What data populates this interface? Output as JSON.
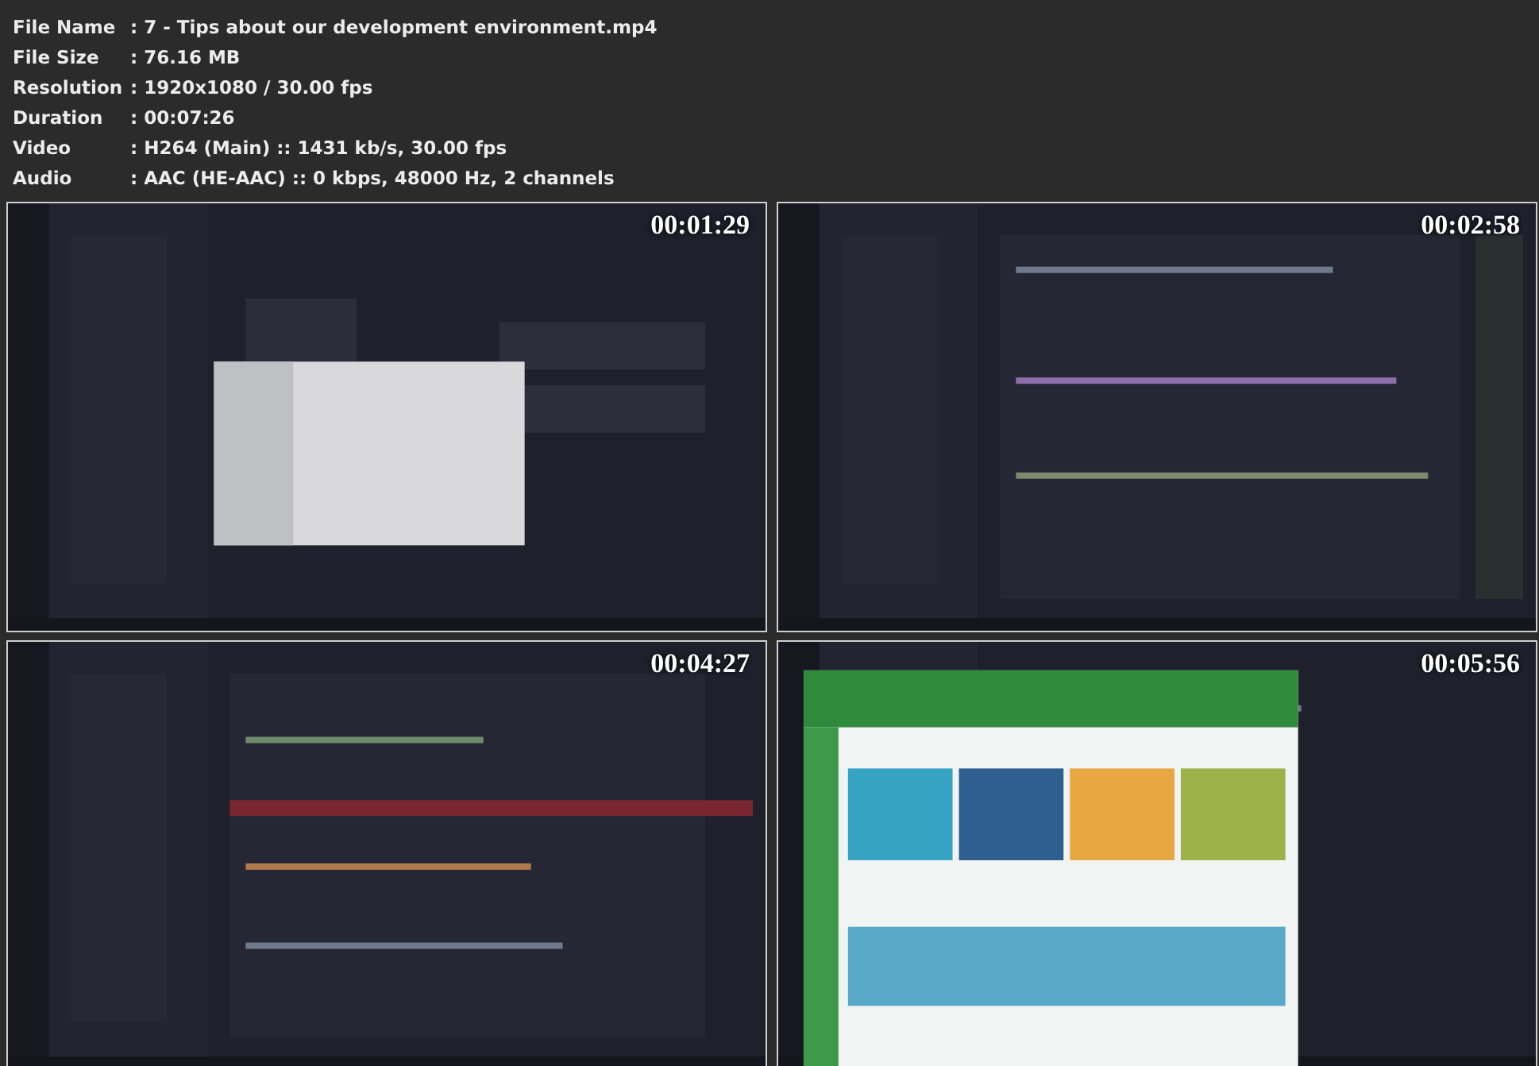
{
  "file_info": [
    {
      "label": "File Name",
      "value": ": 7 - Tips about our development environment.mp4"
    },
    {
      "label": "File Size",
      "value": ": 76.16 MB"
    },
    {
      "label": "Resolution",
      "value": ": 1920x1080 / 30.00 fps"
    },
    {
      "label": "Duration",
      "value": ": 00:07:26"
    },
    {
      "label": "Video",
      "value": ": H264 (Main) :: 1431 kb/s, 30.00 fps"
    },
    {
      "label": "Audio",
      "value": ": AAC (HE-AAC) :: 0 kbps, 48000 Hz, 2 channels"
    }
  ],
  "thumbnails": [
    {
      "timestamp": "00:01:29"
    },
    {
      "timestamp": "00:02:58"
    },
    {
      "timestamp": "00:04:27"
    },
    {
      "timestamp": "00:05:56"
    }
  ]
}
